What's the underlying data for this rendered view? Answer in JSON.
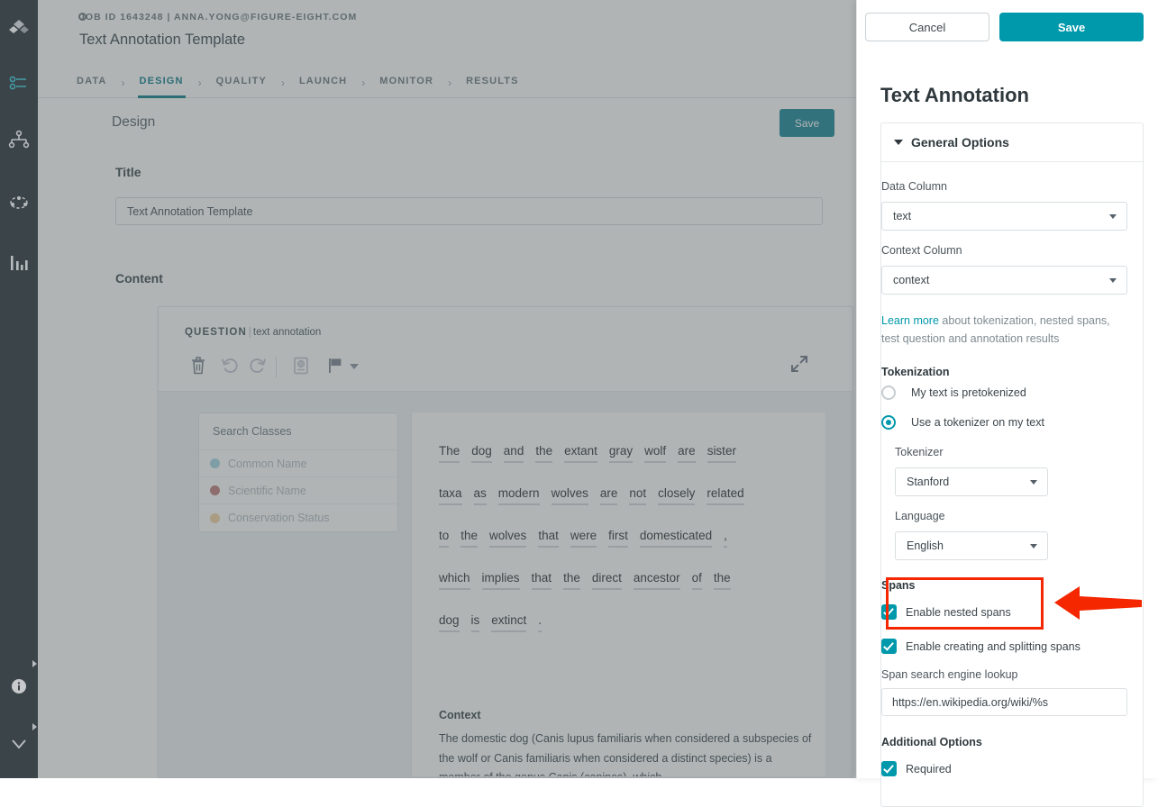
{
  "rail": {
    "items": [
      {
        "name": "logo-diamond-icon",
        "label": "Figure Eight"
      },
      {
        "name": "jobs-icon",
        "label": "Jobs"
      },
      {
        "name": "workflow-icon",
        "label": "Workflows"
      },
      {
        "name": "team-icon",
        "label": "Team"
      },
      {
        "name": "analytics-icon",
        "label": "Analytics"
      },
      {
        "name": "info-icon",
        "label": "Info"
      },
      {
        "name": "collapse-chevron-icon",
        "label": "Collapse"
      }
    ]
  },
  "topbar": {
    "job_meta": "JOB ID 1643248 | ANNA.YONG@FIGURE-EIGHT.COM",
    "job_title": "Text Annotation Template"
  },
  "breadcrumb": {
    "separator": "›",
    "items": [
      {
        "label": "DATA",
        "active": false
      },
      {
        "label": "DESIGN",
        "active": true
      },
      {
        "label": "QUALITY",
        "active": false
      },
      {
        "label": "LAUNCH",
        "active": false
      },
      {
        "label": "MONITOR",
        "active": false
      },
      {
        "label": "RESULTS",
        "active": false
      }
    ]
  },
  "design": {
    "section_heading": "Design",
    "save_label": "Save",
    "title_label": "Title",
    "title_value": "Text Annotation Template",
    "content_label": "Content"
  },
  "question_card": {
    "kind": "QUESTION",
    "divider": "|",
    "type": "text annotation",
    "tools": [
      {
        "name": "delete-icon",
        "label": "Delete"
      },
      {
        "name": "undo-icon",
        "label": "Undo"
      },
      {
        "name": "redo-icon",
        "label": "Redo"
      },
      {
        "name": "dictionary-icon",
        "label": "Lookup"
      },
      {
        "name": "flag-icon",
        "label": "Flag"
      }
    ],
    "expand_label": "Expand",
    "class_search_placeholder": "Search Classes",
    "classes": [
      {
        "label": "Common Name",
        "color": "#a6d6e3"
      },
      {
        "label": "Scientific Name",
        "color": "#c07f7f"
      },
      {
        "label": "Conservation Status",
        "color": "#f2d3a3"
      }
    ],
    "token_lines": [
      [
        "The",
        "dog",
        "and",
        "the",
        "extant",
        "gray",
        "wolf",
        "are",
        "sister"
      ],
      [
        "taxa",
        "as",
        "modern",
        "wolves",
        "are",
        "not",
        "closely",
        "related"
      ],
      [
        "to",
        "the",
        "wolves",
        "that",
        "were",
        "first",
        "domesticated",
        ","
      ],
      [
        "which",
        "implies",
        "that",
        "the",
        "direct",
        "ancestor",
        "of",
        "the"
      ],
      [
        "dog",
        "is",
        "extinct",
        "."
      ]
    ],
    "context_label": "Context",
    "context_text": "The domestic dog (Canis lupus familiaris when considered a subspecies of the wolf or Canis familiaris when considered a distinct species) is a member of the genus Canis (canines), which"
  },
  "panel": {
    "cancel_label": "Cancel",
    "save_label": "Save",
    "title": "Text Annotation",
    "section_header": "General Options",
    "data_column_label": "Data Column",
    "data_column_value": "text",
    "context_column_label": "Context Column",
    "context_column_value": "context",
    "learn_more_link": "Learn more",
    "learn_more_rest": " about tokenization, nested spans, test question and annotation results",
    "tokenization_header": "Tokenization",
    "radio_pretokenized": "My text is pretokenized",
    "radio_use_tokenizer": "Use a tokenizer on my text",
    "tokenizer_label": "Tokenizer",
    "tokenizer_value": "Stanford",
    "language_label": "Language",
    "language_value": "English",
    "spans_header": "Spans",
    "cb_nested_spans": "Enable nested spans",
    "cb_create_split_spans": "Enable creating and splitting spans",
    "span_lookup_label": "Span search engine lookup",
    "span_lookup_value": "https://en.wikipedia.org/wiki/%s",
    "additional_header": "Additional Options",
    "cb_required": "Required"
  },
  "colors": {
    "accent_teal": "#0098ab",
    "save_btn_teal": "#1b8799",
    "rail_bg": "#323c40",
    "annotation_red": "#f42700"
  }
}
